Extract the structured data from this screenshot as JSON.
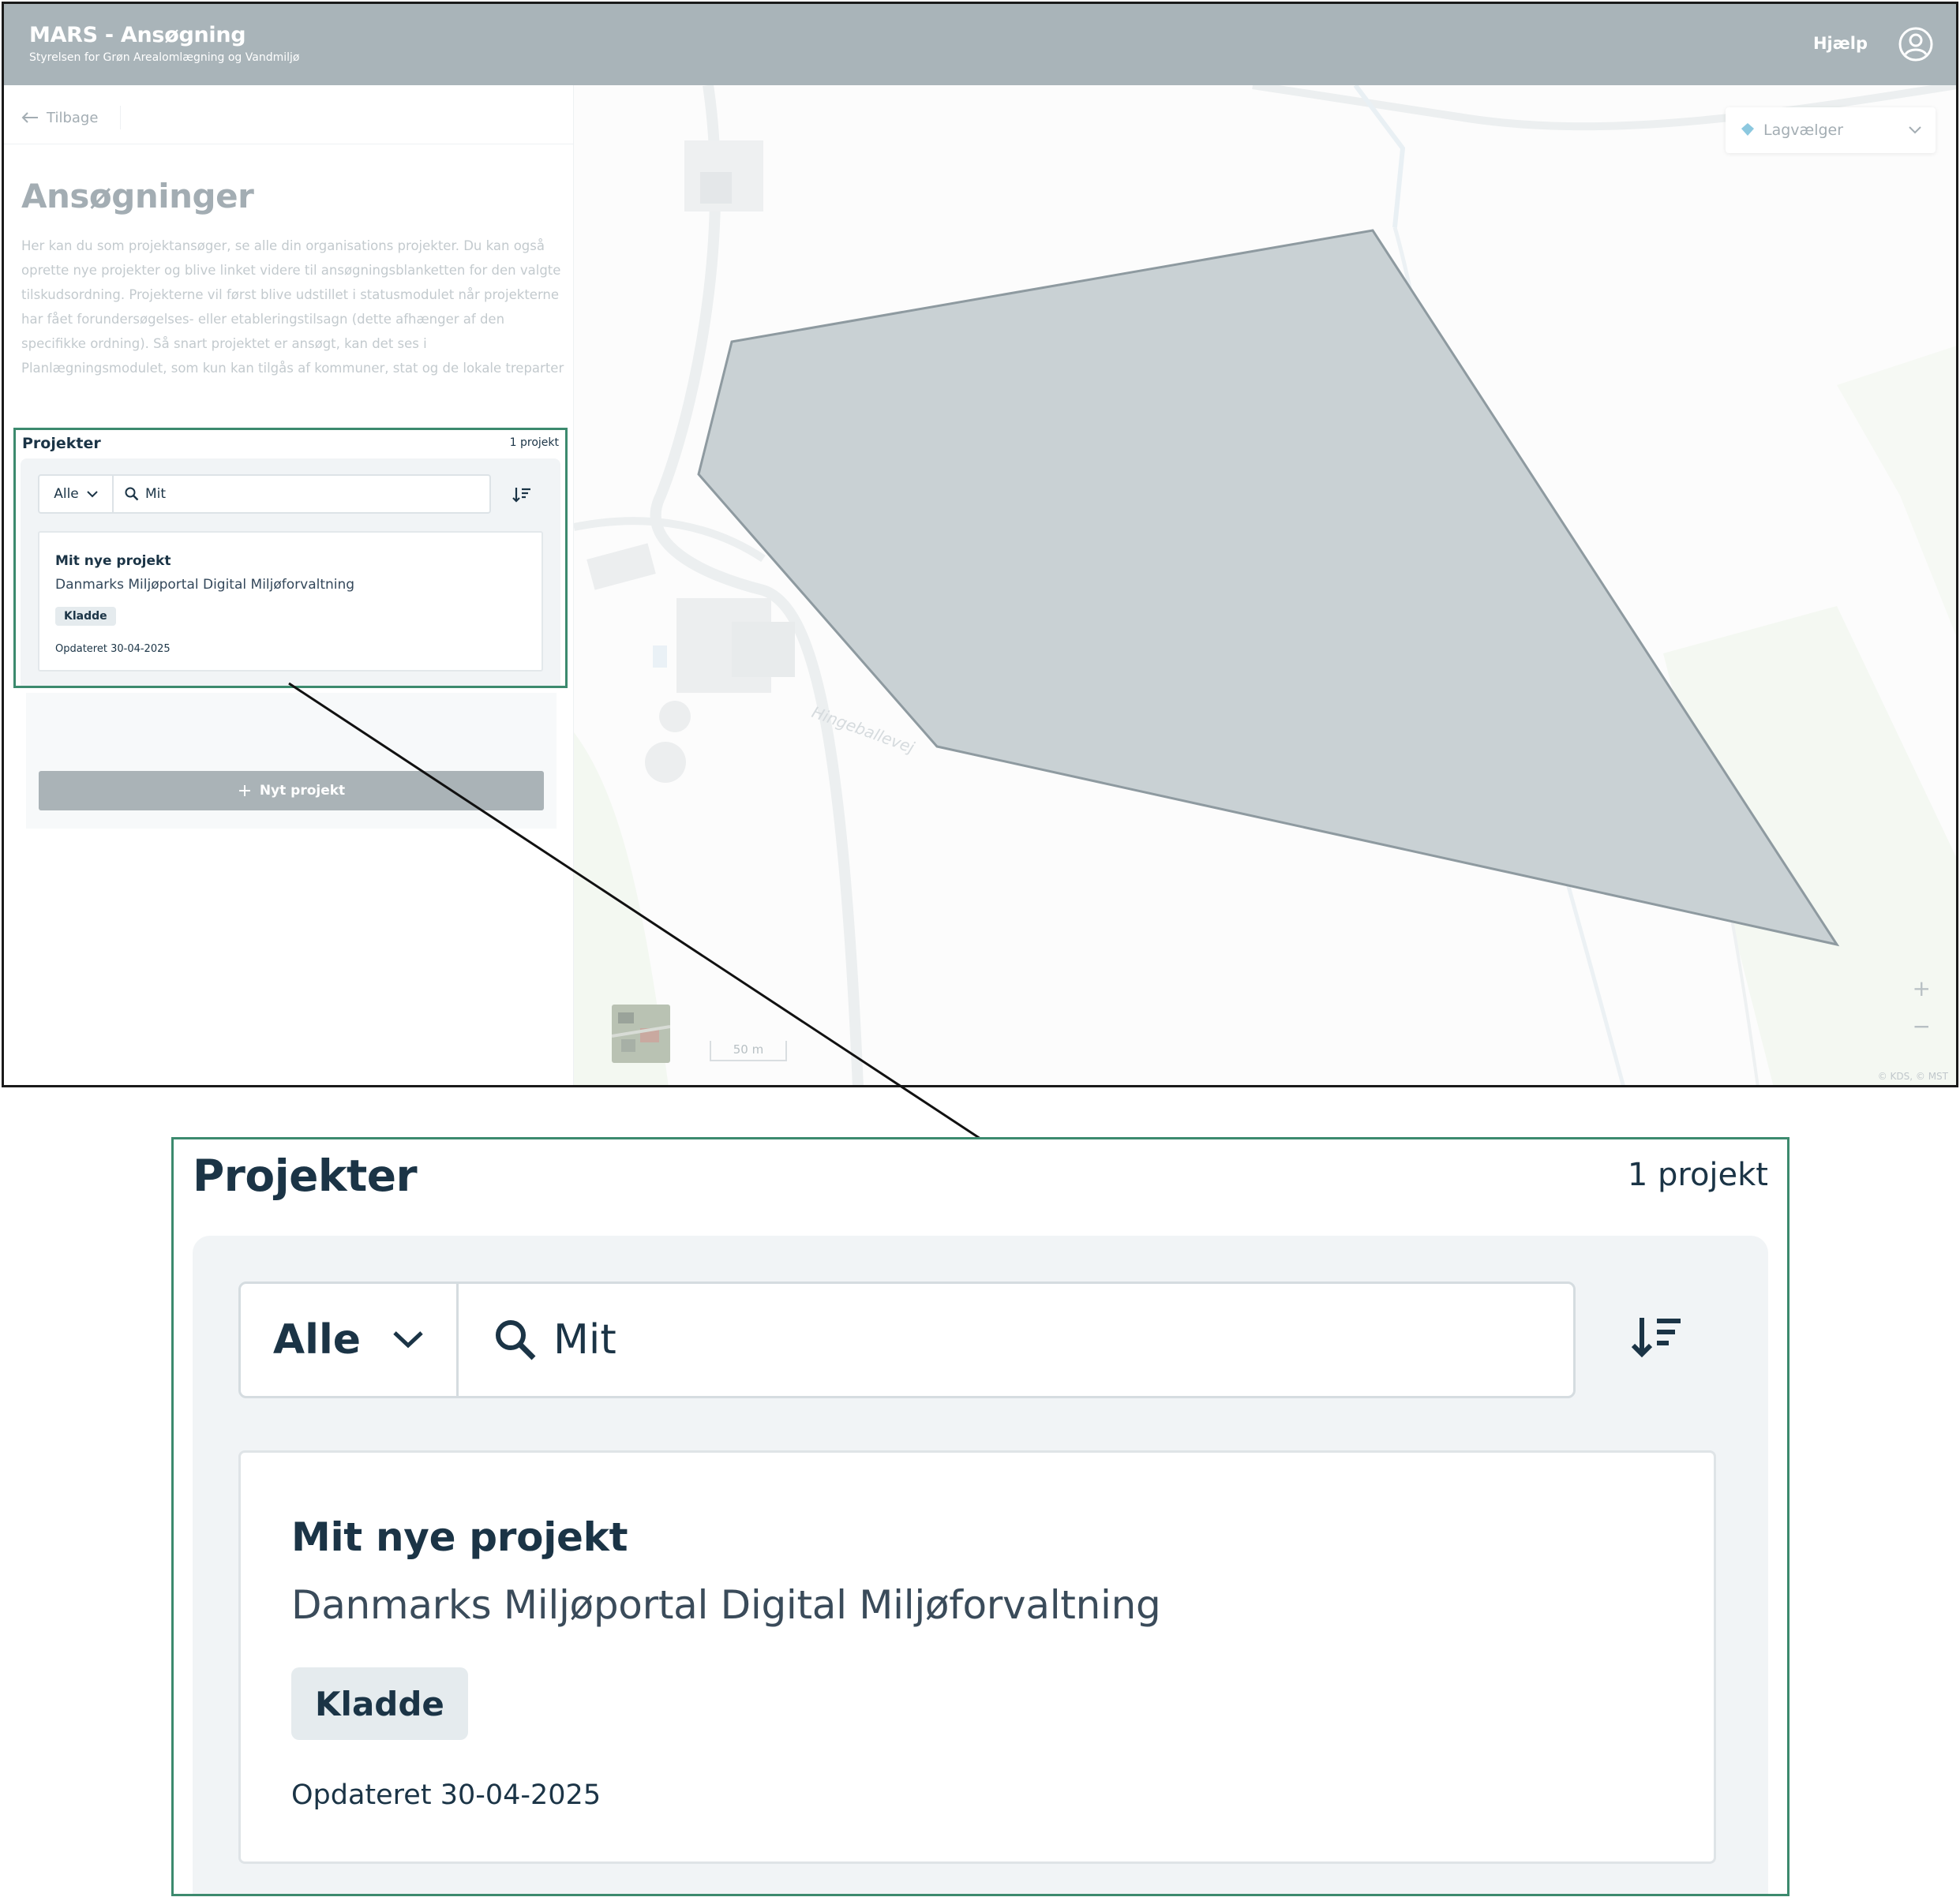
{
  "app": {
    "title": "MARS - Ansøgning",
    "subtitle": "Styrelsen for Grøn Arealomlægning og Vandmiljø",
    "help_label": "Hjælp",
    "user_icon": "user-circle-icon"
  },
  "sidebar": {
    "back_label": "Tilbage",
    "page_title": "Ansøgninger",
    "description": "Her kan du som projektansøger, se alle din organisations projekter. Du kan også oprette nye projekter og blive linket videre til ansøgningsblanketten for den valgte tilskudsordning. Projekterne vil først blive udstillet i statusmodulet når projekterne har fået forundersøgelses- eller etableringstilsagn (dette afhænger af den specifikke ordning). Så snart projektet er ansøgt, kan det ses i Planlægningsmodulet, som kun kan tilgås af kommuner, stat og de lokale treparter",
    "projects": {
      "header": "Projekter",
      "count": "1 projekt",
      "filter_value": "Alle",
      "search_value": "Mit",
      "items": [
        {
          "title": "Mit nye projekt",
          "organization": "Danmarks Miljøportal Digital Miljøforvaltning",
          "status": "Kladde",
          "updated": "Opdateret 30-04-2025"
        }
      ]
    },
    "new_project_label": "Nyt projekt"
  },
  "map": {
    "layer_picker_label": "Lagvælger",
    "road_label": "Hingeballevej",
    "scale_label": "50 m",
    "attribution": "© KDS, © MST",
    "zoom_in": "+",
    "zoom_out": "−"
  },
  "colors": {
    "header_bg": "#a9b4b9",
    "highlight_border": "#3c8a6e",
    "badge_bg": "#e5ebee",
    "polygon_fill": "#c9d1d4"
  }
}
